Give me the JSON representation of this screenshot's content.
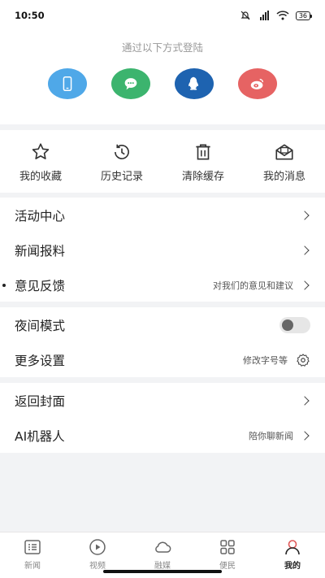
{
  "status_bar": {
    "time": "10:50",
    "signal": "5G",
    "battery": "36"
  },
  "login": {
    "hint": "通过以下方式登陆",
    "methods": [
      {
        "name": "phone-icon",
        "color": "#4fa8e8"
      },
      {
        "name": "wechat-icon",
        "color": "#3cb46e"
      },
      {
        "name": "qq-icon",
        "color": "#1e63b0"
      },
      {
        "name": "weibo-icon",
        "color": "#e66363"
      }
    ]
  },
  "quick_actions": [
    {
      "icon": "star-icon",
      "label": "我的收藏"
    },
    {
      "icon": "history-icon",
      "label": "历史记录"
    },
    {
      "icon": "trash-icon",
      "label": "清除缓存"
    },
    {
      "icon": "message-icon",
      "label": "我的消息"
    }
  ],
  "menu_group_1": {
    "activity_center": "活动中心",
    "news_tip": "新闻报料",
    "feedback": "意见反馈",
    "feedback_hint": "对我们的意见和建议"
  },
  "menu_group_2": {
    "night_mode": "夜间模式",
    "night_mode_on": false,
    "more_settings": "更多设置",
    "more_settings_hint": "修改字号等"
  },
  "menu_group_3": {
    "back_cover": "返回封面",
    "ai_robot": "AI机器人",
    "ai_robot_hint": "陪你聊新闻"
  },
  "tab_bar": {
    "active": "我的",
    "tabs": [
      {
        "icon": "news-icon",
        "label": "新闻"
      },
      {
        "icon": "video-icon",
        "label": "视频"
      },
      {
        "icon": "cloud-icon",
        "label": "融媒"
      },
      {
        "icon": "grid-icon",
        "label": "便民"
      },
      {
        "icon": "user-icon",
        "label": "我的"
      }
    ]
  }
}
